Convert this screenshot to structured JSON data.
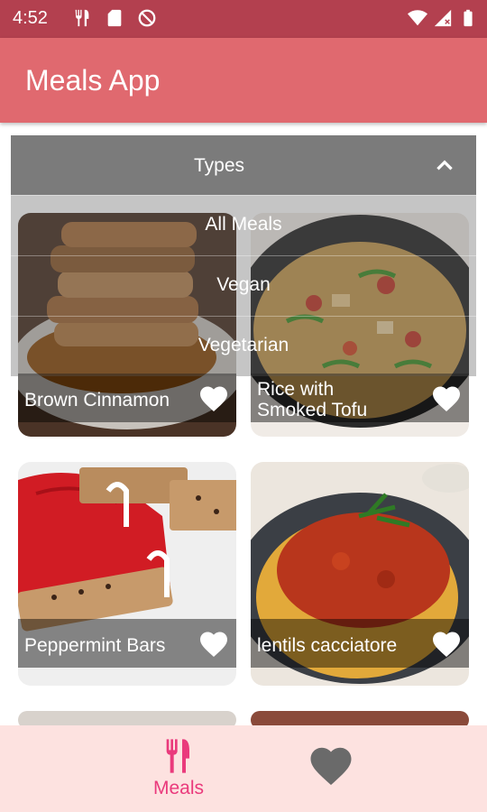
{
  "status_bar": {
    "time": "4:52"
  },
  "app_bar": {
    "title": "Meals App"
  },
  "filter_dropdown": {
    "label": "Types",
    "options": [
      "All Meals",
      "Vegan",
      "Vegetarian"
    ]
  },
  "meals": [
    {
      "name": "Brown Cinnamon"
    },
    {
      "name": "Rice with\nSmoked Tofu"
    },
    {
      "name": "Peppermint Bars"
    },
    {
      "name": "lentils cacciatore"
    }
  ],
  "bottom_nav": {
    "meals_label": "Meals"
  },
  "colors": {
    "status_bar": "#b3404f",
    "app_bar": "#e0696f",
    "bottom_nav": "#fde2e0",
    "active_tab": "#ea3a7c"
  }
}
